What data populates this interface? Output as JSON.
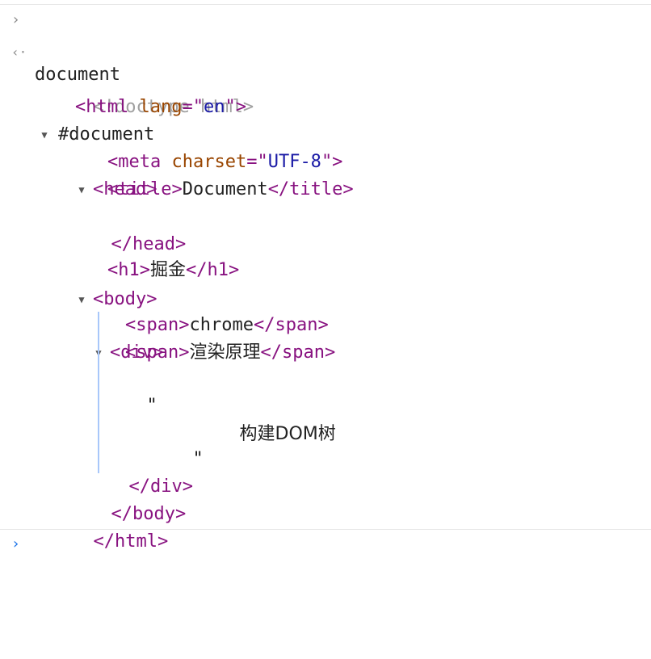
{
  "console": {
    "input_command": "document",
    "result_root": "#document",
    "doctype": "<!doctype html>",
    "html": {
      "open": "<html",
      "attr": "lang",
      "eq": "=\"",
      "val": "en",
      "close": "\">"
    },
    "head": {
      "open": "<head>",
      "close": "</head>"
    },
    "meta": {
      "open": "<meta",
      "attr": "charset",
      "eq": "=\"",
      "val": "UTF-8",
      "close": "\">"
    },
    "title": {
      "open": "<title>",
      "text": "Document",
      "close": "</title>"
    },
    "body": {
      "open": "<body>",
      "close": "</body>"
    },
    "h1": {
      "open": "<h1>",
      "text": "掘金",
      "close": "</h1>"
    },
    "div": {
      "open": "<div>",
      "close": "</div>"
    },
    "span1": {
      "open": "<span>",
      "text": "chrome",
      "close": "</span>"
    },
    "span2": {
      "open": "<span>",
      "text": "渲染原理",
      "close": "</span>"
    },
    "text_node": {
      "quote_open": "\"",
      "text": "构建DOM树",
      "quote_close": "\""
    },
    "html_close": "</html>"
  },
  "icons": {
    "input_prompt": "chevron-right-icon",
    "result_prompt": "return-arrow-icon",
    "expand": "triangle-down-icon",
    "new_prompt": "chevron-right-icon"
  },
  "colors": {
    "tag": "#881280",
    "attr": "#994500",
    "value": "#1a1aa6",
    "muted": "#a0a0a0",
    "prompt_active": "#1a73e8",
    "guide_line": "#a8c7fa"
  }
}
